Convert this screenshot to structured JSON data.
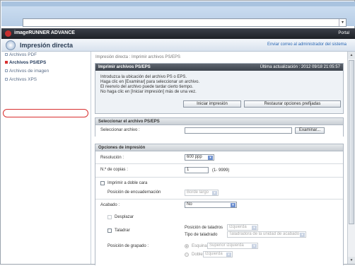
{
  "header": {
    "brand": "imageRUNNER ADVANCE",
    "portal": "Portal",
    "title": "Impresión directa",
    "mail_link": "Enviar correo al administrador del sistema"
  },
  "sidebar": {
    "items": [
      {
        "label": "Archivos PDF"
      },
      {
        "label": "Archivos PS/EPS"
      },
      {
        "label": "Archivos de imagen"
      },
      {
        "label": "Archivos XPS"
      }
    ]
  },
  "main": {
    "breadcrumb": "Impresión directa : Imprimir archivos PS/EPS",
    "print_panel": {
      "title": "Imprimir archivos PS/EPS",
      "updated": "Última actualización : 2012 09/18 21:05:57",
      "instructions": [
        "Introduzca la ubicación del archivo PS o EPS.",
        "Haga clic en [Examinar] para seleccionar un archivo.",
        "El reenvío del archivo puede tardar cierto tiempo.",
        "No haga clic en [Iniciar impresión] más de una vez."
      ],
      "start_button": "Iniciar impresión",
      "restore_button": "Restaurar opciones prefijadas"
    },
    "select_panel": {
      "title": "Seleccionar el archivo PS/EPS",
      "label": "Seleccionar archivo :",
      "browse_button": "Examinar..."
    },
    "options_panel": {
      "title": "Opciones de impresión",
      "resolution_label": "Resolución :",
      "resolution_value": "600 ppp",
      "copies_label": "N.º de copias :",
      "copies_value": "1",
      "copies_range": "(1- 9999)",
      "duplex_label": "Imprimir a doble cara",
      "binding_label": "Posición de encuadernación",
      "binding_value": "Borde largo",
      "finishing_label": "Acabado :",
      "finishing_value": "No",
      "offset_label": "Desplazar",
      "punch_label": "Taladrar",
      "punch_position_label": "Posición de taladros",
      "punch_position_value": "Izquierda",
      "punch_type_label": "Tipo de taladrado",
      "punch_type_value": "Taladradora de la unidad de acabado",
      "staple_label": "Posición de grapado :",
      "corner_label": "Esquina",
      "corner_value": "Superior izquierda",
      "double_label": "Doble",
      "double_value": "Izquierda"
    }
  }
}
